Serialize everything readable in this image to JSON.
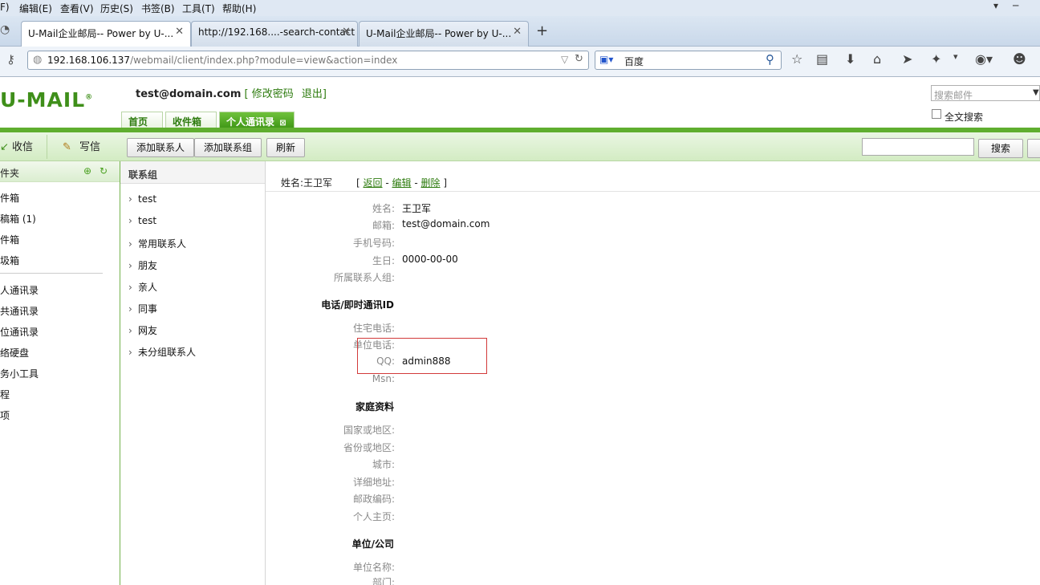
{
  "browser": {
    "menu": [
      "F)",
      "编辑(E)",
      "查看(V)",
      "历史(S)",
      "书签(B)",
      "工具(T)",
      "帮助(H)"
    ],
    "tabs": [
      {
        "label": "U-Mail企业邮局-- Power by U-..."
      },
      {
        "label": "http://192.168....-search-contact"
      },
      {
        "label": "U-Mail企业邮局-- Power by U-..."
      }
    ],
    "new_tab": "+",
    "url_host": "192.168.106.137",
    "url_path": "/webmail/client/index.php?module=view&action=index",
    "search_engine": "百度"
  },
  "app": {
    "logo": "U-MAIL",
    "user_email": "test@domain.com",
    "change_password": "修改密码",
    "logout": "退出",
    "bracket_open": "[",
    "bracket_close": "]",
    "search_mail_placeholder": "搜索邮件",
    "fulltext_search": "全文搜索",
    "tabs": [
      "首页",
      "收件箱",
      "个人通讯录"
    ],
    "accent": "#5fae2f"
  },
  "toolbar": {
    "receive": "收信",
    "compose": "写信",
    "add_contact": "添加联系人",
    "add_group": "添加联系组",
    "refresh": "刷新",
    "search": "搜索"
  },
  "folders": {
    "header": "件夹",
    "items": [
      "件箱",
      "稿箱 (1)",
      "件箱",
      "圾箱"
    ],
    "tools": [
      "人通讯录",
      "共通讯录",
      "位通讯录",
      "络硬盘",
      "务小工具",
      "程",
      "项"
    ]
  },
  "groups": {
    "header": "联系组",
    "items": [
      "test",
      "test",
      "常用联系人",
      "朋友",
      "亲人",
      "同事",
      "网友",
      "未分组联系人"
    ]
  },
  "detail": {
    "name_line": "姓名:王卫军",
    "actions_open": "[",
    "back": "返回",
    "edit": "编辑",
    "delete": "删除",
    "actions_close": "]",
    "sep": "-",
    "fields": {
      "name_label": "姓名:",
      "name": "王卫军",
      "email_label": "邮箱:",
      "email": "test@domain.com",
      "mobile_label": "手机号码:",
      "birthday_label": "生日:",
      "birthday": "0000-00-00",
      "group_label": "所属联系人组:"
    },
    "im_section": "电话/即时通讯ID",
    "im": {
      "home_phone_label": "住宅电话:",
      "work_phone_label": "单位电话:",
      "qq_label": "QQ:",
      "qq": "admin888",
      "msn_label": "Msn:"
    },
    "home_section": "家庭资料",
    "home": {
      "country_label": "国家或地区:",
      "province_label": "省份或地区:",
      "city_label": "城市:",
      "address_label": "详细地址:",
      "zip_label": "邮政编码:",
      "homepage_label": "个人主页:"
    },
    "company_section": "单位/公司",
    "company": {
      "company_label": "单位名称:",
      "dept_label": "部门:"
    }
  }
}
